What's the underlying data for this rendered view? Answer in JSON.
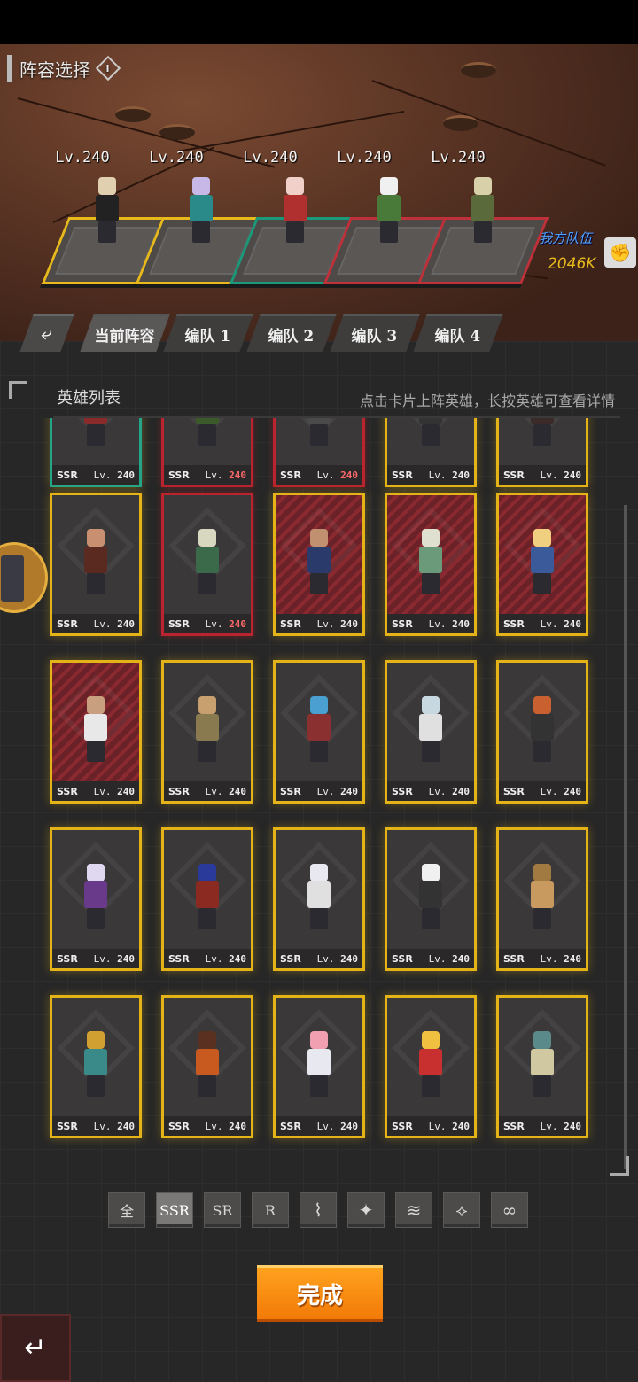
{
  "lineup": {
    "title": "阵容选择",
    "info_icon": "i",
    "heroes": [
      {
        "level": "Lv.240",
        "frame": "gold",
        "color": "#e0d0b0",
        "body": "#222"
      },
      {
        "level": "Lv.240",
        "frame": "gold",
        "color": "#c8b8e8",
        "body": "#2a8a8a"
      },
      {
        "level": "Lv.240",
        "frame": "teal",
        "color": "#f0d0c8",
        "body": "#b03030"
      },
      {
        "level": "Lv.240",
        "frame": "red",
        "color": "#f0f0f0",
        "body": "#4a7a3a"
      },
      {
        "level": "Lv.240",
        "frame": "red",
        "color": "#d8d0a8",
        "body": "#5a6a3a"
      }
    ],
    "team_tag": "我方队伍",
    "team_power": "2046K"
  },
  "tabs": [
    {
      "label": "当前阵容",
      "active": true
    },
    {
      "label": "编队 1",
      "active": false
    },
    {
      "label": "编队 2",
      "active": false
    },
    {
      "label": "编队 3",
      "active": false
    },
    {
      "label": "编队 4",
      "active": false
    }
  ],
  "hero_list": {
    "title": "英雄列表",
    "hint": "点击卡片上阵英雄，长按英雄可查看详情",
    "rarity": "SSR",
    "level_prefix": "Lv.",
    "level": "240",
    "rows": [
      [
        {
          "style": "teal",
          "head": "#d0a080",
          "body": "#8a2a2a"
        },
        {
          "style": "redframe",
          "head": "#8ab060",
          "body": "#3a5a2a"
        },
        {
          "style": "redframe",
          "head": "#c0c0c0",
          "body": "#4a4a4a"
        },
        {
          "style": "gold",
          "head": "#d0a080",
          "body": "#333"
        },
        {
          "style": "gold",
          "head": "#d0a080",
          "body": "#3a2a2a"
        }
      ],
      [
        {
          "style": "gold",
          "head": "#c89070",
          "body": "#5a2a20"
        },
        {
          "style": "redframe",
          "head": "#d8d8c0",
          "body": "#3a6a4a"
        },
        {
          "style": "redbg",
          "head": "#c09070",
          "body": "#2a3a6a"
        },
        {
          "style": "redbg",
          "head": "#e0e0d0",
          "body": "#6a9a7a"
        },
        {
          "style": "redbg",
          "head": "#f0d080",
          "body": "#3a5a9a"
        }
      ],
      [
        {
          "style": "redbg",
          "head": "#c8a080",
          "body": "#e8e8e8"
        },
        {
          "style": "gold",
          "head": "#c8a070",
          "body": "#8a7a50"
        },
        {
          "style": "gold",
          "head": "#4aa0d0",
          "body": "#8a3030"
        },
        {
          "style": "gold",
          "head": "#c8d8e0",
          "body": "#e0e0e0"
        },
        {
          "style": "gold",
          "head": "#c86030",
          "body": "#333"
        }
      ],
      [
        {
          "style": "gold",
          "head": "#e0d8f0",
          "body": "#6a3a8a"
        },
        {
          "style": "gold",
          "head": "#2a3a9a",
          "body": "#8a2a20"
        },
        {
          "style": "gold",
          "head": "#e8e8f0",
          "body": "#e0e0e0"
        },
        {
          "style": "gold",
          "head": "#f0f0f0",
          "body": "#333"
        },
        {
          "style": "gold",
          "head": "#a07a40",
          "body": "#c89a60"
        }
      ],
      [
        {
          "style": "gold",
          "head": "#d0a030",
          "body": "#3a8a8a"
        },
        {
          "style": "gold",
          "head": "#5a3020",
          "body": "#c85a20"
        },
        {
          "style": "gold",
          "head": "#f0a0b0",
          "body": "#e8e8f0"
        },
        {
          "style": "gold",
          "head": "#f0c040",
          "body": "#c83030"
        },
        {
          "style": "gold",
          "head": "#5a8a8a",
          "body": "#d0c8a0"
        }
      ]
    ]
  },
  "filters": [
    {
      "label": "全",
      "active": false,
      "icon": ""
    },
    {
      "label": "SSR",
      "active": true,
      "icon": ""
    },
    {
      "label": "SR",
      "active": false,
      "icon": ""
    },
    {
      "label": "R",
      "active": false,
      "icon": ""
    },
    {
      "label": "",
      "active": false,
      "icon": "faction-1-icon"
    },
    {
      "label": "",
      "active": false,
      "icon": "faction-2-icon"
    },
    {
      "label": "",
      "active": false,
      "icon": "faction-3-icon"
    },
    {
      "label": "",
      "active": false,
      "icon": "faction-4-icon"
    },
    {
      "label": "",
      "active": false,
      "icon": "faction-5-icon"
    }
  ],
  "filter_icons": [
    "⌇",
    "✦",
    "≋",
    "⟡",
    "∞"
  ],
  "done_label": "完成",
  "back_icon": "↵",
  "tab_back_icon": "⤶",
  "fist_icon": "✊",
  "colors": {
    "gold": "#e3b317",
    "red": "#b9242e",
    "teal": "#23a58a",
    "orange": "#f27a08",
    "team_blue": "#4ea2ff"
  }
}
